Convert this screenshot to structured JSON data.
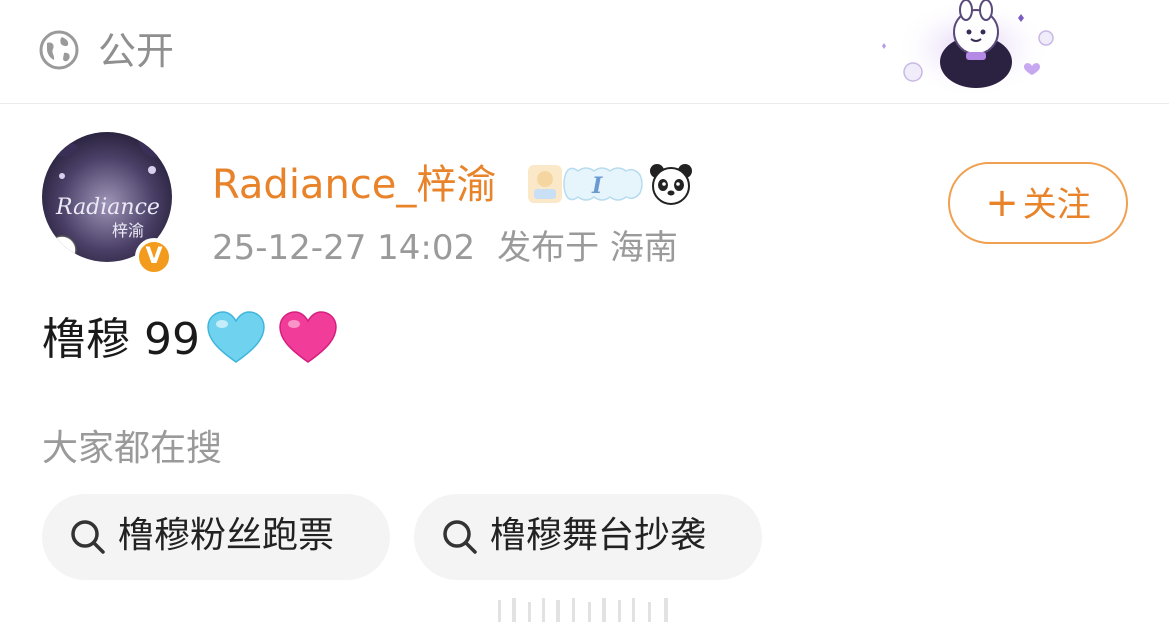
{
  "visibility": {
    "icon": "globe-icon",
    "label": "公开"
  },
  "author": {
    "name": "Radiance_梓渝",
    "avatar_text": "Radiance",
    "avatar_text_2": "梓渝",
    "badge_text": "V",
    "medal_text": "I",
    "medal_icon": "medal-badge",
    "extra_icon": "panda-icon"
  },
  "post": {
    "date": "25-12-27 14:02",
    "location": "发布于 海南",
    "text": "橹穆 99",
    "emojis": [
      "light-blue-heart",
      "pink-heart"
    ]
  },
  "follow_button": {
    "plus": "+",
    "label": "关注"
  },
  "trending": {
    "label": "大家都在搜",
    "chips": [
      {
        "label": "橹穆粉丝跑票",
        "icon": "search-icon"
      },
      {
        "label": "橹穆舞台抄袭",
        "icon": "search-icon"
      }
    ]
  },
  "colors": {
    "accent": "#e8832a",
    "muted_text": "#9a9a9a",
    "chip_bg": "#f4f4f4",
    "heart_blue": "#6fd3f0",
    "heart_pink": "#f23c9a",
    "verified": "#f29b1c"
  }
}
